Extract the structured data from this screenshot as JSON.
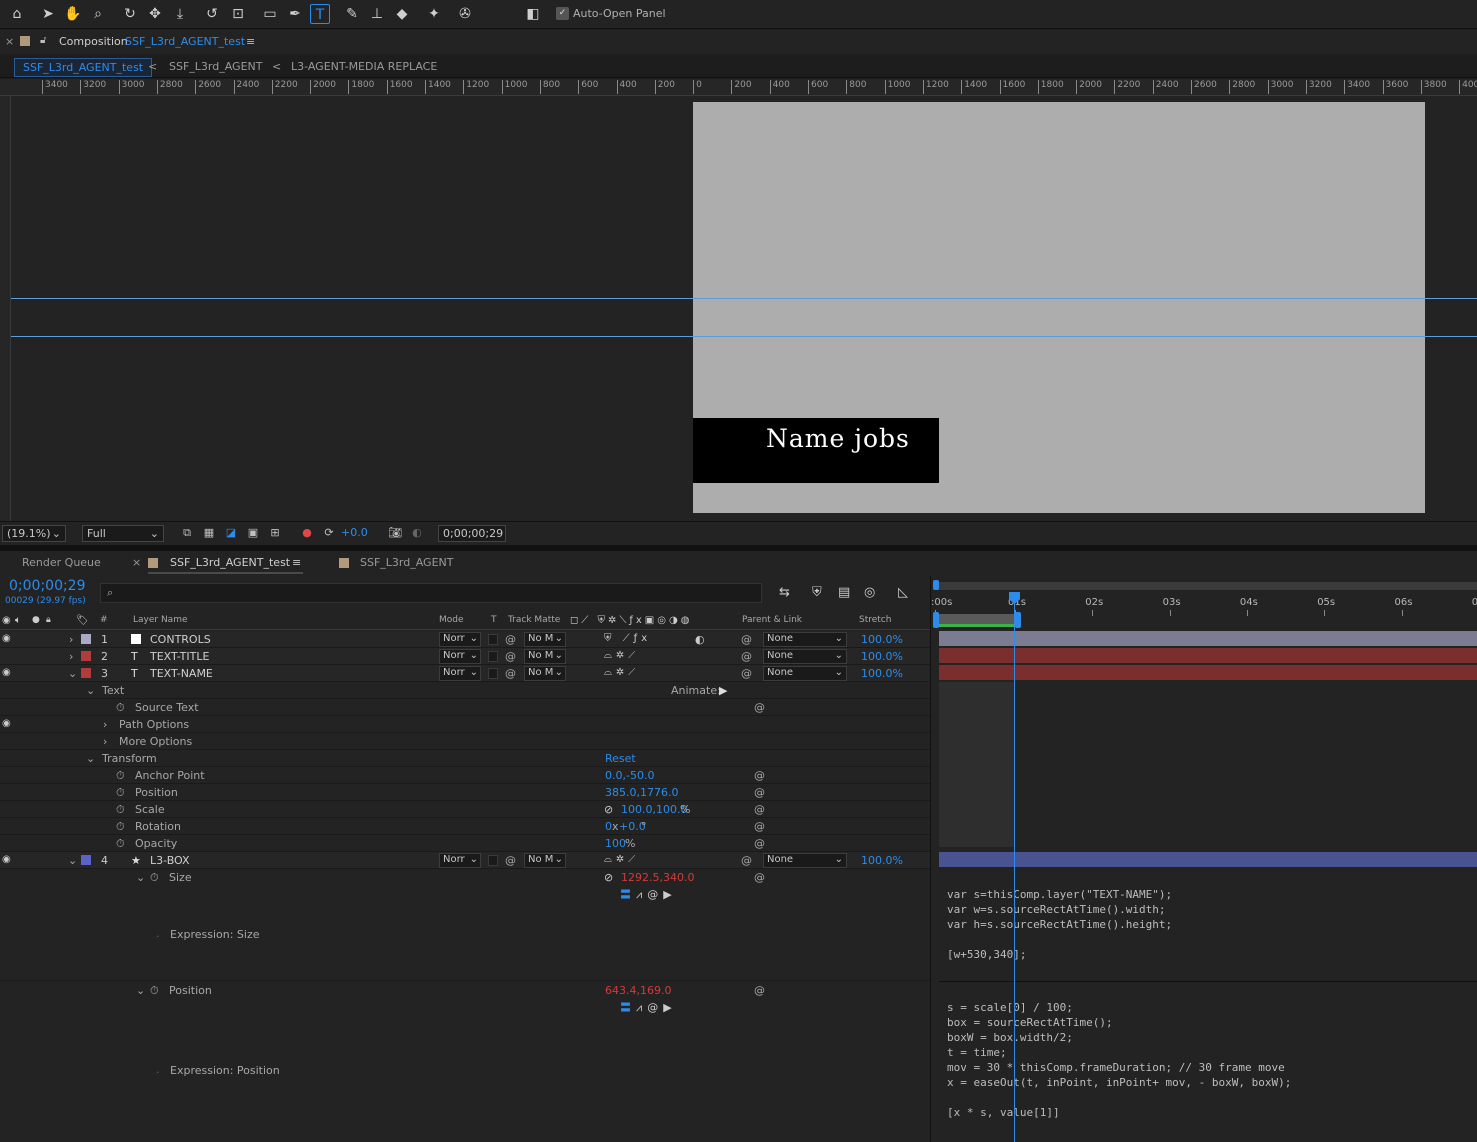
{
  "toolbar": {
    "auto_open_label": "Auto-Open Panel",
    "check": "✓"
  },
  "comp_header": {
    "close": "×",
    "label": "Composition",
    "name": "SSF_L3rd_AGENT_test",
    "menu": "≡"
  },
  "nav": {
    "items": [
      "SSF_L3rd_AGENT_test",
      "SSF_L3rd_AGENT",
      "L3-AGENT-MEDIA REPLACE"
    ],
    "arrow": "<"
  },
  "ruler": {
    "ticks": [
      "3400",
      "3200",
      "3000",
      "2800",
      "2600",
      "2400",
      "2200",
      "2000",
      "1800",
      "1600",
      "1400",
      "1200",
      "1000",
      "800",
      "600",
      "400",
      "200",
      "0",
      "200",
      "400",
      "600",
      "800",
      "1000",
      "1200",
      "1400",
      "1600",
      "1800",
      "2000",
      "2200",
      "2400",
      "2600",
      "2800",
      "3000",
      "3200",
      "3400",
      "3600",
      "3800",
      "4000"
    ]
  },
  "preview": {
    "name_text": "Name jobs"
  },
  "viewer_bar": {
    "zoom": "(19.1%)",
    "resolution": "Full",
    "exposure": "+0.0",
    "timecode": "0;00;00;29"
  },
  "timeline_tabs": {
    "render_queue": "Render Queue",
    "close": "×",
    "tab1": "SSF_L3rd_AGENT_test",
    "tab1_menu": "≡",
    "tab2": "SSF_L3rd_AGENT"
  },
  "timeline": {
    "timecode": "0;00;00;29",
    "frames": "00029 (29.97 fps)",
    "search_placeholder": "",
    "columns": {
      "hash": "#",
      "layer_name": "Layer Name",
      "mode": "Mode",
      "t": "T",
      "track_matte": "Track Matte",
      "parent": "Parent & Link",
      "stretch": "Stretch"
    },
    "time_labels": [
      ":00s",
      "01s",
      "02s",
      "03s",
      "04s",
      "05s",
      "06s",
      "0"
    ],
    "layers": [
      {
        "num": "1",
        "type": "",
        "name": "CONTROLS",
        "mode": "Norr",
        "matte": "No M",
        "parent": "None",
        "stretch": "100.0%",
        "color": "#a9a9c8",
        "swatch": "#ffffff"
      },
      {
        "num": "2",
        "type": "T",
        "name": "TEXT-TITLE",
        "mode": "Norr",
        "matte": "No M",
        "parent": "None",
        "stretch": "100.0%",
        "color": "#b23b3b"
      },
      {
        "num": "3",
        "type": "T",
        "name": "TEXT-NAME",
        "mode": "Norr",
        "matte": "No M",
        "parent": "None",
        "stretch": "100.0%",
        "color": "#b23b3b"
      },
      {
        "num": "4",
        "type": "★",
        "name": "L3-BOX",
        "mode": "Norr",
        "matte": "No M",
        "parent": "None",
        "stretch": "100.0%",
        "color": "#5b63c8"
      }
    ],
    "props": {
      "text": "Text",
      "animate": "Animate:",
      "source_text": "Source Text",
      "path_options": "Path Options",
      "more_options": "More Options",
      "transform": "Transform",
      "reset": "Reset",
      "anchor_point": "Anchor Point",
      "anchor_val": "0.0,-50.0",
      "position": "Position",
      "position_val": "385.0,1776.0",
      "scale": "Scale",
      "scale_val": "100.0,100.0",
      "scale_unit": "%",
      "rotation": "Rotation",
      "rotation_val": "0",
      "rotation_x": "x",
      "rotation_deg": "+0.0",
      "rotation_unit": "°",
      "opacity": "Opacity",
      "opacity_val": "100",
      "opacity_unit": "%",
      "size": "Size",
      "size_val": "1292.5,340.0",
      "expr_size": "Expression: Size",
      "pos2": "Position",
      "pos2_val": "643.4,169.0",
      "expr_pos": "Expression: Position"
    },
    "code_size": "var s=thisComp.layer(\"TEXT-NAME\");\nvar w=s.sourceRectAtTime().width;\nvar h=s.sourceRectAtTime().height;\n\n[w+530,340];",
    "code_pos": "s = scale[0] / 100;\nbox = sourceRectAtTime();\nboxW = box.width/2;\nt = time;\nmov = 30 * thisComp.frameDuration; // 30 frame move\nx = easeOut(t, inPoint, inPoint+ mov, - boxW, boxW);\n\n[x * s, value[1]]"
  }
}
